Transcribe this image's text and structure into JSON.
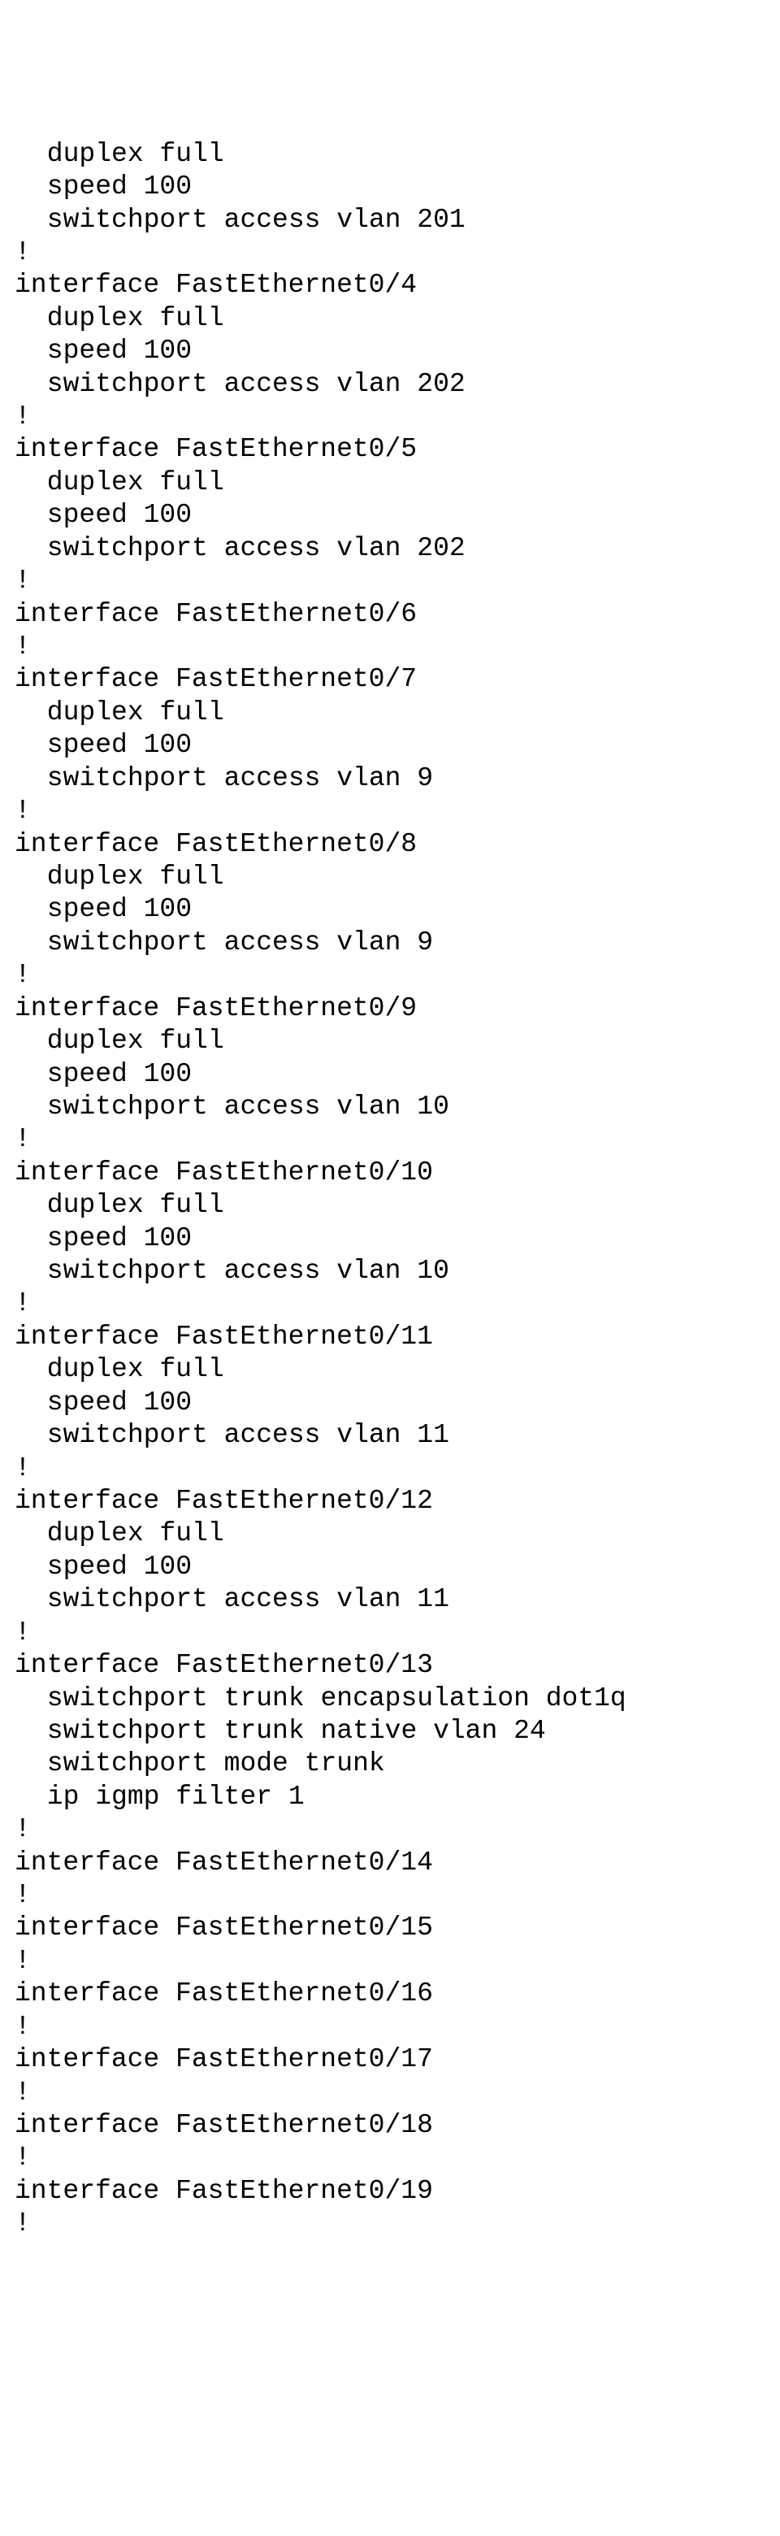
{
  "lines": [
    {
      "indent": 1,
      "text": " duplex full"
    },
    {
      "indent": 1,
      "text": " speed 100"
    },
    {
      "indent": 1,
      "text": " switchport access vlan 201"
    },
    {
      "indent": 0,
      "text": "!"
    },
    {
      "indent": 0,
      "text": "interface FastEthernet0/4"
    },
    {
      "indent": 1,
      "text": " duplex full"
    },
    {
      "indent": 1,
      "text": " speed 100"
    },
    {
      "indent": 1,
      "text": " switchport access vlan 202"
    },
    {
      "indent": 0,
      "text": "!"
    },
    {
      "indent": 0,
      "text": "interface FastEthernet0/5"
    },
    {
      "indent": 1,
      "text": " duplex full"
    },
    {
      "indent": 1,
      "text": " speed 100"
    },
    {
      "indent": 1,
      "text": " switchport access vlan 202"
    },
    {
      "indent": 0,
      "text": "!"
    },
    {
      "indent": 0,
      "text": "interface FastEthernet0/6"
    },
    {
      "indent": 0,
      "text": "!"
    },
    {
      "indent": 0,
      "text": "interface FastEthernet0/7"
    },
    {
      "indent": 1,
      "text": " duplex full"
    },
    {
      "indent": 1,
      "text": " speed 100"
    },
    {
      "indent": 1,
      "text": " switchport access vlan 9"
    },
    {
      "indent": 0,
      "text": "!"
    },
    {
      "indent": 0,
      "text": "interface FastEthernet0/8"
    },
    {
      "indent": 1,
      "text": " duplex full"
    },
    {
      "indent": 1,
      "text": " speed 100"
    },
    {
      "indent": 1,
      "text": " switchport access vlan 9"
    },
    {
      "indent": 0,
      "text": "!"
    },
    {
      "indent": 0,
      "text": "interface FastEthernet0/9"
    },
    {
      "indent": 1,
      "text": " duplex full"
    },
    {
      "indent": 1,
      "text": " speed 100"
    },
    {
      "indent": 1,
      "text": " switchport access vlan 10"
    },
    {
      "indent": 0,
      "text": "!"
    },
    {
      "indent": 0,
      "text": "interface FastEthernet0/10"
    },
    {
      "indent": 1,
      "text": " duplex full"
    },
    {
      "indent": 1,
      "text": " speed 100"
    },
    {
      "indent": 1,
      "text": " switchport access vlan 10"
    },
    {
      "indent": 0,
      "text": "!"
    },
    {
      "indent": 0,
      "text": "interface FastEthernet0/11"
    },
    {
      "indent": 1,
      "text": " duplex full"
    },
    {
      "indent": 1,
      "text": " speed 100"
    },
    {
      "indent": 1,
      "text": " switchport access vlan 11"
    },
    {
      "indent": 0,
      "text": "!"
    },
    {
      "indent": 0,
      "text": "interface FastEthernet0/12"
    },
    {
      "indent": 1,
      "text": " duplex full"
    },
    {
      "indent": 1,
      "text": " speed 100"
    },
    {
      "indent": 1,
      "text": " switchport access vlan 11"
    },
    {
      "indent": 0,
      "text": "!"
    },
    {
      "indent": 0,
      "text": "interface FastEthernet0/13"
    },
    {
      "indent": 1,
      "text": " switchport trunk encapsulation dot1q"
    },
    {
      "indent": 1,
      "text": " switchport trunk native vlan 24"
    },
    {
      "indent": 1,
      "text": " switchport mode trunk"
    },
    {
      "indent": 1,
      "text": " ip igmp filter 1"
    },
    {
      "indent": 0,
      "text": "!"
    },
    {
      "indent": 0,
      "text": "interface FastEthernet0/14"
    },
    {
      "indent": 0,
      "text": "!"
    },
    {
      "indent": 0,
      "text": "interface FastEthernet0/15"
    },
    {
      "indent": 0,
      "text": "!"
    },
    {
      "indent": 0,
      "text": "interface FastEthernet0/16"
    },
    {
      "indent": 0,
      "text": "!"
    },
    {
      "indent": 0,
      "text": "interface FastEthernet0/17"
    },
    {
      "indent": 0,
      "text": "!"
    },
    {
      "indent": 0,
      "text": "interface FastEthernet0/18"
    },
    {
      "indent": 0,
      "text": "!"
    },
    {
      "indent": 0,
      "text": "interface FastEthernet0/19"
    },
    {
      "indent": 0,
      "text": "!"
    }
  ]
}
